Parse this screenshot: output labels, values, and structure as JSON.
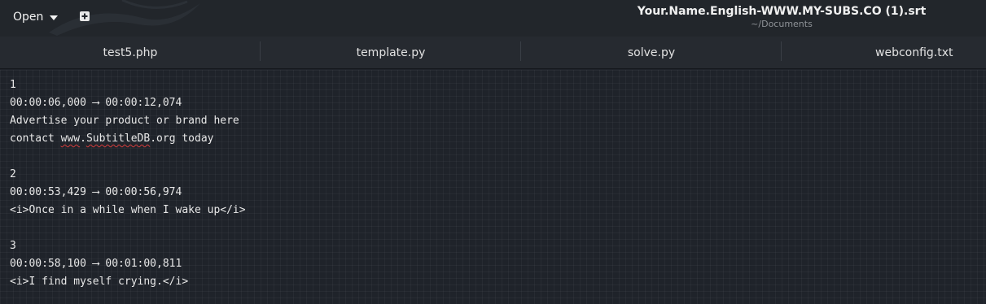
{
  "header": {
    "open_label": "Open",
    "title": "Your.Name.English-WWW.MY-SUBS.CO (1).srt",
    "subtitle": "~/Documents",
    "icons": {
      "open_caret": "chevron-down-icon",
      "new_document": "new-document-icon"
    }
  },
  "tabs": [
    {
      "label": "test5.php"
    },
    {
      "label": "template.py"
    },
    {
      "label": "solve.py"
    },
    {
      "label": "webconfig.txt"
    }
  ],
  "editor": {
    "lines": [
      "1",
      "00:00:06,000 ⟶ 00:00:12,074",
      "Advertise your product or brand here",
      "",
      "",
      "2",
      "00:00:53,429 ⟶ 00:00:56,974",
      "<i>Once in a while when I wake up</i>",
      "",
      "3",
      "00:00:58,100 ⟶ 00:01:00,811",
      "<i>I find myself crying.</i>"
    ],
    "contact_line": {
      "before": "contact ",
      "misspelled_1": "www",
      "middle": ".",
      "misspelled_2": "SubtitleDB",
      "after": ".org today"
    }
  },
  "colors": {
    "background": "#1f232a",
    "header": "#22262b",
    "tabbar": "#262a30",
    "spellcheck_underline": "#d43c3c"
  }
}
